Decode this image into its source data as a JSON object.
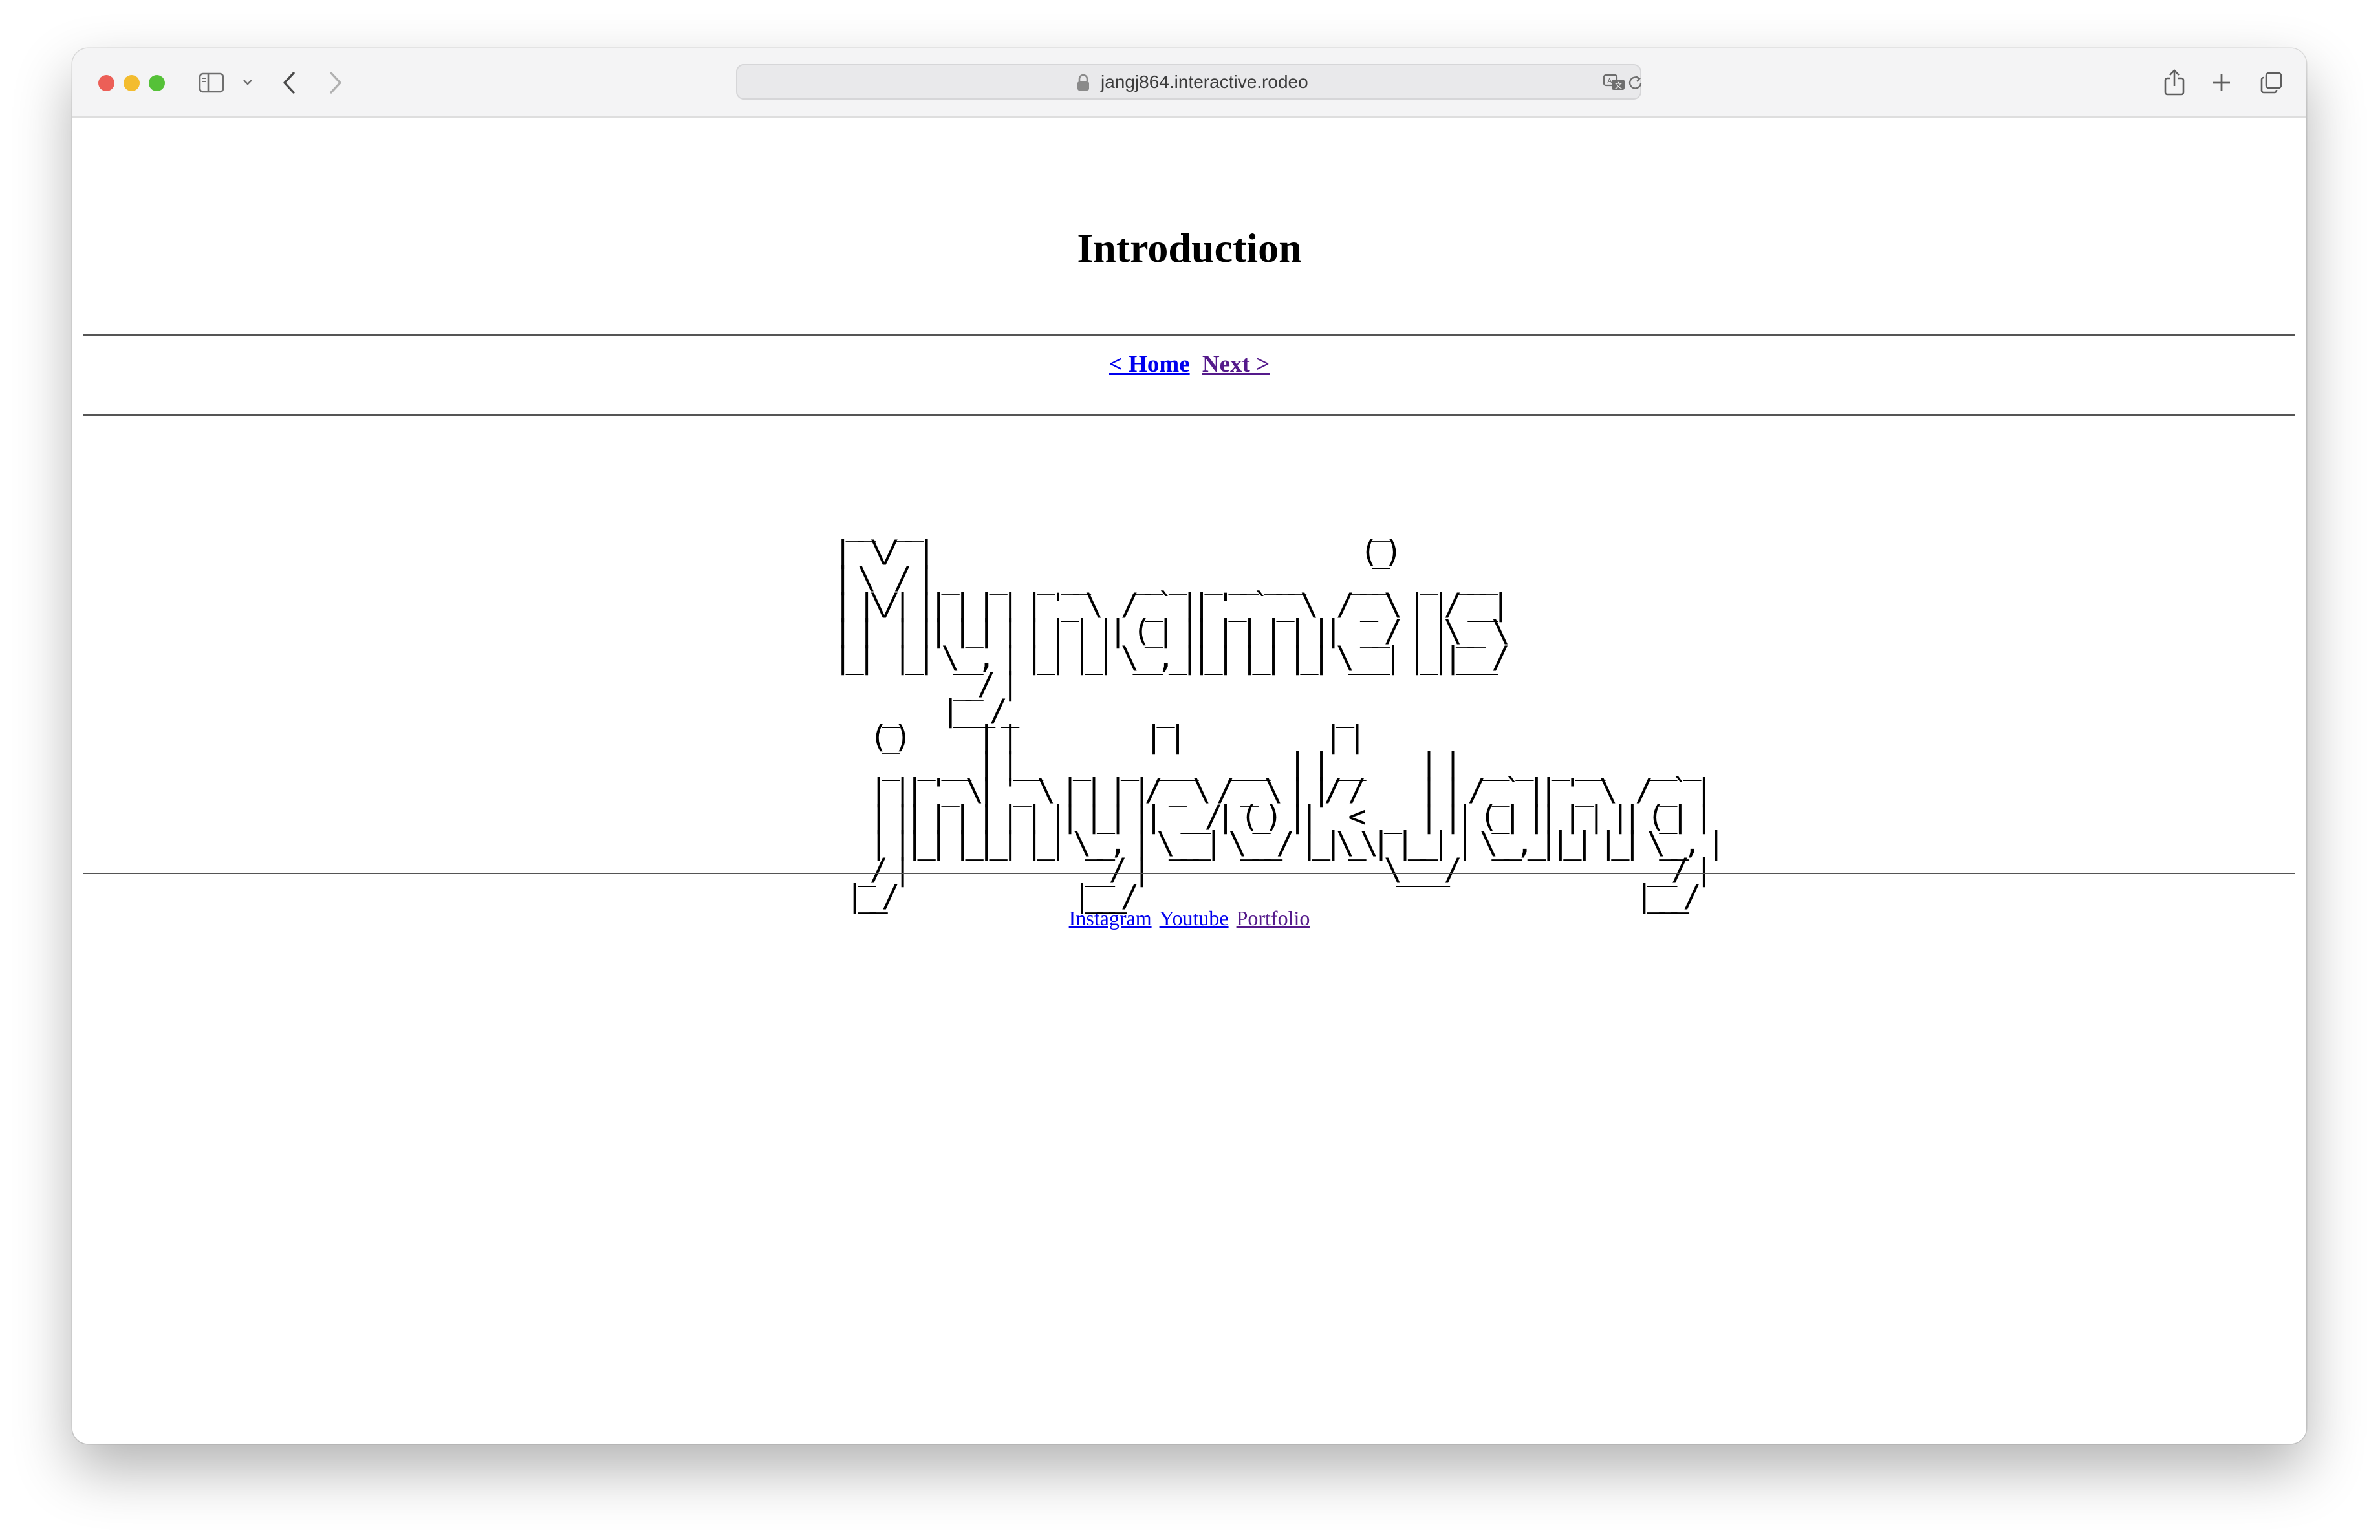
{
  "browser": {
    "url": "jangj864.interactive.rodeo",
    "icons": [
      "sidebar-icon",
      "chevron-down-icon",
      "back-arrow-icon",
      "forward-arrow-icon",
      "lock-icon",
      "translate-icon",
      "reload-icon",
      "share-icon",
      "new-tab-icon",
      "tab-overview-icon"
    ]
  },
  "page": {
    "title": "Introduction",
    "nav": {
      "home_label": "< Home",
      "next_label": "Next >"
    },
    "ascii_art": " __  __                                      _     \n|  \\/  |                                    (_)    \n| \\  / | _   _   _ __    __ _  _ __ ___    ___   _  ___ \n| |\\/| || | | | | '_ \\  / _` || '_ ` _ \\  / _ \\ | |/ __|\n| |  | || |_| | | | | || (_| || | | | | ||  __/ | |\\__ \\\n|_|  |_| \\__, | |_| |_| \\__,_||_| |_| |_| \\___| |_||___/\n          __/ |                                        \n    _    |___/_            _              _            \n   (_)      | |           | |            | |           \n    _  _ __ | |__   _   _  ___   ___  | | __     | |  __ _  _ __    __ _ \n   | || '_ \\| '_ \\ | | | |/ _ \\ / _ \\ | |/ /     | | / _` || '_ \\  / _` |\n   | || | | | | | || |_| ||  __/| (_) ||   <  _  | || (_| || | | || (_| |\n   | ||_| |_|_| |_| \\__, | \\___| \\___/ |_|\\_\\| |__| | \\__,_||_| |_| \\__, |\n  _/ |               __/ |                    \\____/                __/ |\n |__/               |___/                                          |___/ ",
    "footer_links": {
      "instagram": "Instagram",
      "youtube": "Youtube",
      "portfolio": "Portfolio"
    }
  },
  "colors": {
    "link": "#0000ee",
    "visited_link": "#551a8b",
    "toolbar_bg": "#f4f4f5"
  }
}
